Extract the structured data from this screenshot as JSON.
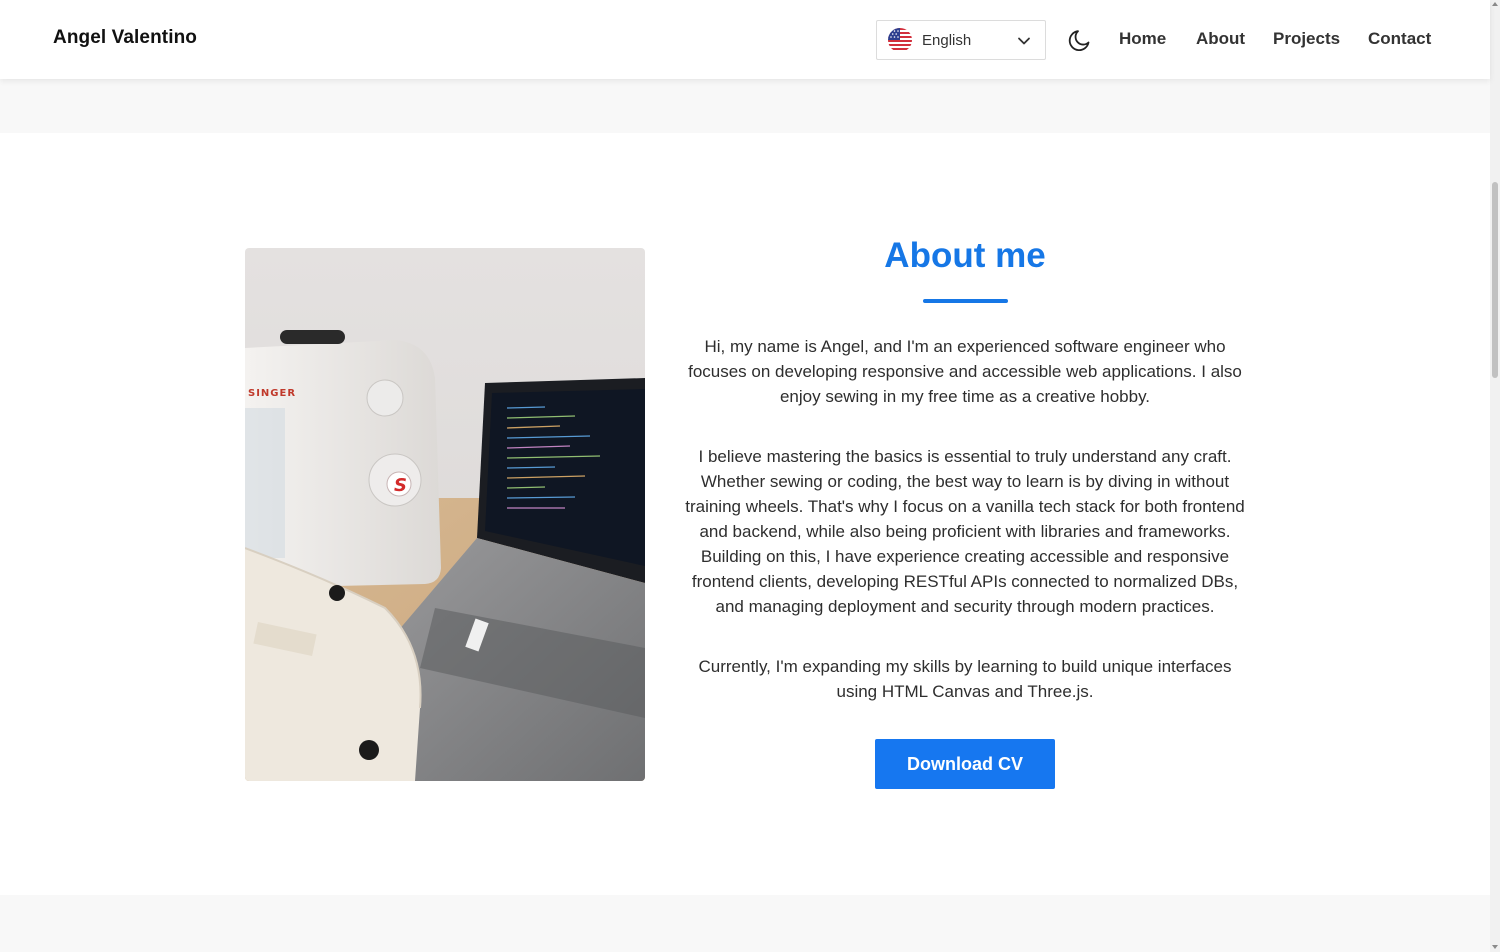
{
  "header": {
    "brand": "Angel Valentino",
    "language": {
      "selected": "English",
      "flag_icon": "us-flag-icon"
    },
    "theme_toggle_icon": "moon-icon",
    "nav": [
      {
        "label": "Home"
      },
      {
        "label": "About"
      },
      {
        "label": "Projects"
      },
      {
        "label": "Contact"
      }
    ]
  },
  "about": {
    "title": "About me",
    "accent_color": "#1677e6",
    "paragraphs": [
      "Hi, my name is Angel, and I'm an experienced software engineer who focuses on developing responsive and accessible web applications. I also enjoy sewing in my free time as a creative hobby.",
      "I believe mastering the basics is essential to truly understand any craft. Whether sewing or coding, the best way to learn is by diving in without training wheels. That's why I focus on a vanilla tech stack for both frontend and backend, while also being proficient with libraries and frameworks. Building on this, I have experience creating accessible and responsive frontend clients, developing RESTful APIs connected to normalized DBs, and managing deployment and security through modern practices.",
      "Currently, I'm expanding my skills by learning to build unique interfaces using HTML Canvas and Three.js."
    ],
    "cta_label": "Download CV",
    "photo_brand_text": "SINGER"
  }
}
